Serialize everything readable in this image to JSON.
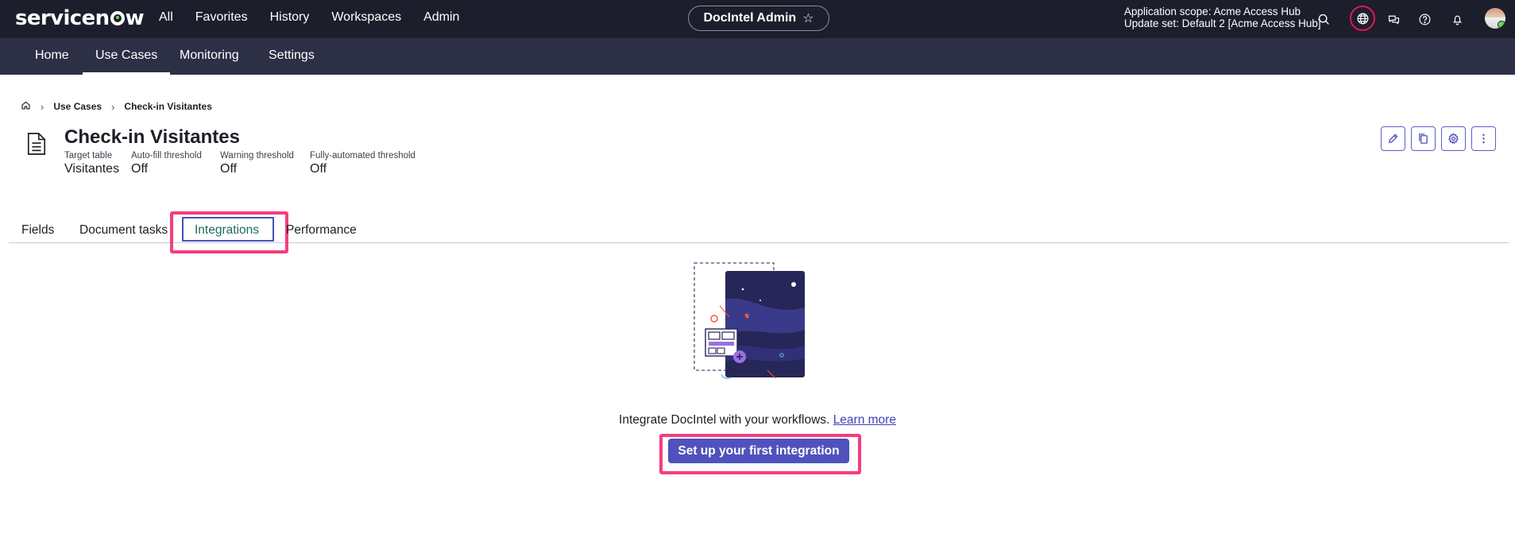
{
  "topbar": {
    "logo_text_start": "servicen",
    "logo_text_end": "w",
    "nav": [
      "All",
      "Favorites",
      "History",
      "Workspaces",
      "Admin"
    ],
    "app_pill": "DocIntel Admin",
    "scope_line1": "Application scope: Acme Access Hub",
    "scope_line2": "Update set: Default 2 [Acme Access Hub]",
    "icons": [
      "search-icon",
      "globe-icon",
      "chat-icon",
      "help-icon",
      "bell-icon",
      "avatar"
    ]
  },
  "subnav": {
    "items": [
      "Home",
      "Use Cases",
      "Monitoring",
      "Settings"
    ],
    "active": "Use Cases"
  },
  "breadcrumb": {
    "items": [
      "Use Cases",
      "Check-in Visitantes"
    ]
  },
  "header": {
    "title": "Check-in Visitantes",
    "meta": [
      {
        "label": "Target table",
        "value": "Visitantes"
      },
      {
        "label": "Auto-fill threshold",
        "value": "Off"
      },
      {
        "label": "Warning threshold",
        "value": "Off"
      },
      {
        "label": "Fully-automated threshold",
        "value": "Off"
      }
    ],
    "actions": [
      "edit-icon",
      "copy-icon",
      "gear-icon",
      "more-icon"
    ]
  },
  "tabs": {
    "items": [
      "Fields",
      "Document tasks",
      "Integrations",
      "Performance"
    ],
    "active": "Integrations"
  },
  "empty_state": {
    "text": "Integrate DocIntel with your workflows.",
    "link": "Learn more",
    "button": "Set up your first integration"
  },
  "colors": {
    "topbar_bg": "#1d1e2c",
    "subnav_bg": "#2d2f45",
    "primary": "#4f52bd",
    "highlight": "#f43e7d",
    "active_tab": "#1a6b5b"
  }
}
